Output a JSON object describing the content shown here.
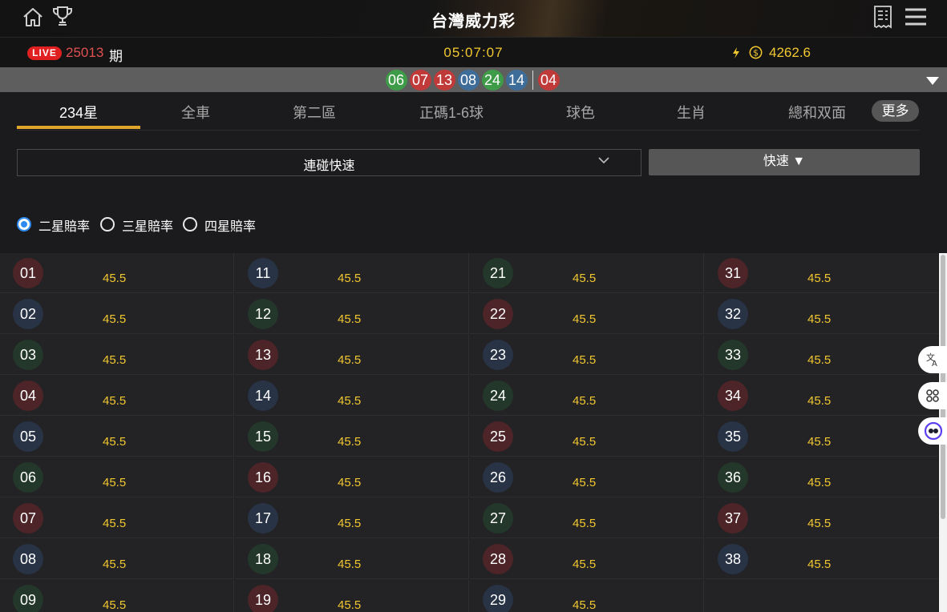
{
  "header": {
    "title": "台灣威力彩"
  },
  "status": {
    "live_badge": "LIVE",
    "period_number": "25013",
    "period_suffix": "期",
    "countdown": "05:07:07",
    "balance": "4262.6"
  },
  "last_result": {
    "balls": [
      {
        "num": "06",
        "color": "green"
      },
      {
        "num": "07",
        "color": "red"
      },
      {
        "num": "13",
        "color": "red"
      },
      {
        "num": "08",
        "color": "blue"
      },
      {
        "num": "24",
        "color": "green"
      },
      {
        "num": "14",
        "color": "blue"
      }
    ],
    "special": {
      "num": "04",
      "color": "red"
    }
  },
  "tabs": [
    {
      "label": "234星",
      "active": true
    },
    {
      "label": "全車",
      "active": false
    },
    {
      "label": "第二區",
      "active": false
    },
    {
      "label": "正碼1-6球",
      "active": false
    },
    {
      "label": "球色",
      "active": false
    },
    {
      "label": "生肖",
      "active": false
    },
    {
      "label": "總和双面",
      "active": false
    }
  ],
  "more_label": "更多",
  "bet_type_select": {
    "value": "連碰快速"
  },
  "mode_button": {
    "label": "快速 ▼"
  },
  "odds_options": [
    {
      "label": "二星賠率",
      "selected": true
    },
    {
      "label": "三星賠率",
      "selected": false
    },
    {
      "label": "四星賠率",
      "selected": false
    }
  ],
  "numbers": [
    {
      "num": "01",
      "color": "red",
      "odds": "45.5"
    },
    {
      "num": "02",
      "color": "blue",
      "odds": "45.5"
    },
    {
      "num": "03",
      "color": "green",
      "odds": "45.5"
    },
    {
      "num": "04",
      "color": "red",
      "odds": "45.5"
    },
    {
      "num": "05",
      "color": "blue",
      "odds": "45.5"
    },
    {
      "num": "06",
      "color": "green",
      "odds": "45.5"
    },
    {
      "num": "07",
      "color": "red",
      "odds": "45.5"
    },
    {
      "num": "08",
      "color": "blue",
      "odds": "45.5"
    },
    {
      "num": "09",
      "color": "green",
      "odds": "45.5"
    },
    {
      "num": "11",
      "color": "blue",
      "odds": "45.5"
    },
    {
      "num": "12",
      "color": "green",
      "odds": "45.5"
    },
    {
      "num": "13",
      "color": "red",
      "odds": "45.5"
    },
    {
      "num": "14",
      "color": "blue",
      "odds": "45.5"
    },
    {
      "num": "15",
      "color": "green",
      "odds": "45.5"
    },
    {
      "num": "16",
      "color": "red",
      "odds": "45.5"
    },
    {
      "num": "17",
      "color": "blue",
      "odds": "45.5"
    },
    {
      "num": "18",
      "color": "green",
      "odds": "45.5"
    },
    {
      "num": "19",
      "color": "red",
      "odds": "45.5"
    },
    {
      "num": "21",
      "color": "green",
      "odds": "45.5"
    },
    {
      "num": "22",
      "color": "red",
      "odds": "45.5"
    },
    {
      "num": "23",
      "color": "blue",
      "odds": "45.5"
    },
    {
      "num": "24",
      "color": "green",
      "odds": "45.5"
    },
    {
      "num": "25",
      "color": "red",
      "odds": "45.5"
    },
    {
      "num": "26",
      "color": "blue",
      "odds": "45.5"
    },
    {
      "num": "27",
      "color": "green",
      "odds": "45.5"
    },
    {
      "num": "28",
      "color": "red",
      "odds": "45.5"
    },
    {
      "num": "29",
      "color": "blue",
      "odds": "45.5"
    },
    {
      "num": "31",
      "color": "red",
      "odds": "45.5"
    },
    {
      "num": "32",
      "color": "blue",
      "odds": "45.5"
    },
    {
      "num": "33",
      "color": "green",
      "odds": "45.5"
    },
    {
      "num": "34",
      "color": "red",
      "odds": "45.5"
    },
    {
      "num": "35",
      "color": "blue",
      "odds": "45.5"
    },
    {
      "num": "36",
      "color": "green",
      "odds": "45.5"
    },
    {
      "num": "37",
      "color": "red",
      "odds": "45.5"
    },
    {
      "num": "38",
      "color": "blue",
      "odds": "45.5"
    }
  ],
  "colors": {
    "accent": "#e0a62c",
    "gold": "#f2c830",
    "live_red": "#e02020",
    "ball_red": "#c03a3a",
    "ball_green": "#3e9c48",
    "ball_blue": "#3f6d9a"
  },
  "icons": [
    "home-icon",
    "trophy-icon",
    "receipt-icon",
    "menu-icon",
    "refresh-icon",
    "coin-icon",
    "caret-down-icon",
    "chevron-down-icon",
    "translate-icon",
    "apps-icon",
    "assistant-icon"
  ]
}
